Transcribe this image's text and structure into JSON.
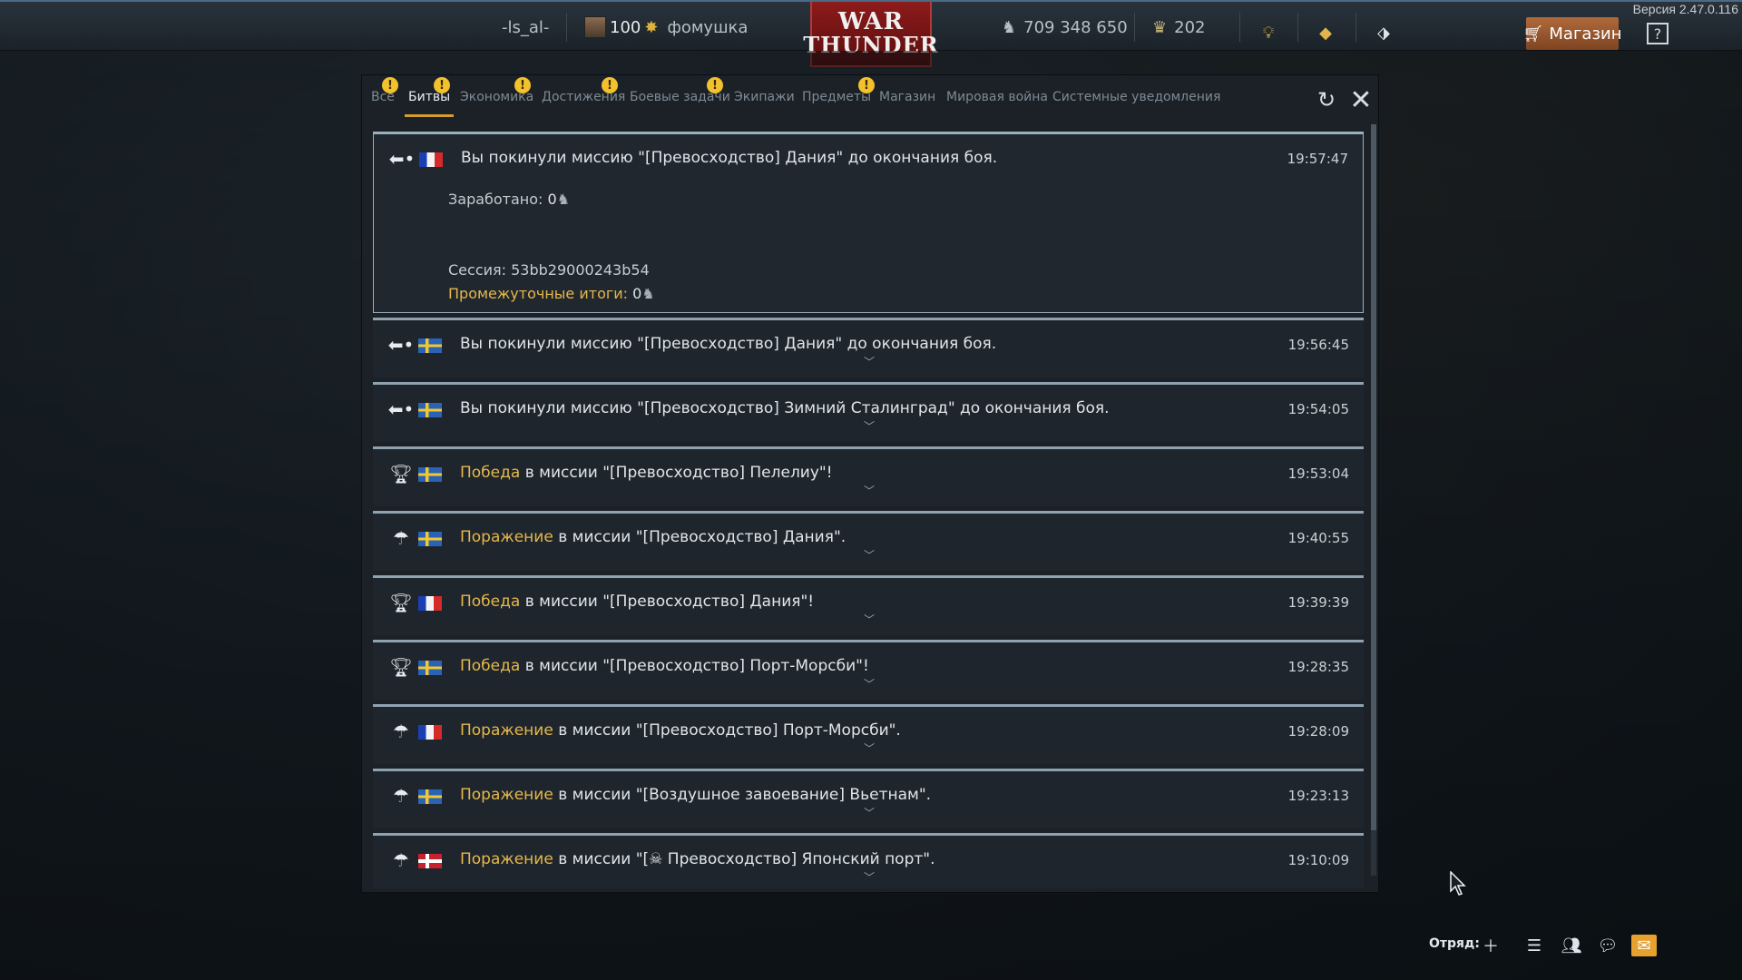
{
  "version": "Версия 2.47.0.116",
  "topbar": {
    "player_name": "-ls_al-",
    "level": "100",
    "title": "фомушка",
    "logo_line1": "WAR",
    "logo_line2": "THUNDER",
    "silver_lions": "709 348 650",
    "golden_eagles": "202",
    "shop_label": "Магазин",
    "help_label": "?"
  },
  "tabs": [
    {
      "label": "Все",
      "badge": "!"
    },
    {
      "label": "Битвы",
      "badge": "!",
      "active": true
    },
    {
      "label": "Экономика",
      "badge": "!"
    },
    {
      "label": "Достижения",
      "badge": "!"
    },
    {
      "label": "Боевые задачи",
      "badge": "!"
    },
    {
      "label": "Экипажи",
      "badge": ""
    },
    {
      "label": "Предметы",
      "badge": "!"
    },
    {
      "label": "Магазин",
      "badge": ""
    },
    {
      "label": "Мировая война",
      "badge": ""
    },
    {
      "label": "Системные уведомления",
      "badge": ""
    }
  ],
  "messages": [
    {
      "icon": "leave-icon",
      "flag": "france",
      "title": "Вы покинули миссию \"[Превосходство] Дания\" до окончания боя.",
      "time": "19:57:47",
      "earned_label": "Заработано:",
      "earned_value": "0",
      "session_label": "Сессия:",
      "session_value": "53bb29000243b54",
      "interim_label": "Промежуточные итоги:",
      "interim_value": "0"
    },
    {
      "icon": "leave-icon",
      "flag": "sweden",
      "result": "",
      "title": "Вы покинули миссию \"[Превосходство] Дания\" до окончания боя.",
      "time": "19:56:45"
    },
    {
      "icon": "leave-icon",
      "flag": "sweden",
      "result": "",
      "title": "Вы покинули миссию \"[Превосходство] Зимний Сталинград\" до окончания боя.",
      "time": "19:54:05"
    },
    {
      "icon": "trophy-icon",
      "flag": "sweden",
      "result": "Победа",
      "title": " в миссии \"[Превосходство] Пелелиу\"!",
      "time": "19:53:04"
    },
    {
      "icon": "parachute-icon",
      "flag": "sweden",
      "result": "Поражение",
      "title": " в миссии \"[Превосходство] Дания\".",
      "time": "19:40:55"
    },
    {
      "icon": "trophy-icon",
      "flag": "france",
      "result": "Победа",
      "title": " в миссии \"[Превосходство] Дания\"!",
      "time": "19:39:39"
    },
    {
      "icon": "trophy-icon",
      "flag": "sweden",
      "result": "Победа",
      "title": " в миссии \"[Превосходство] Порт-Морсби\"!",
      "time": "19:28:35"
    },
    {
      "icon": "parachute-icon",
      "flag": "france",
      "result": "Поражение",
      "title": " в миссии \"[Превосходство] Порт-Морсби\".",
      "time": "19:28:09"
    },
    {
      "icon": "parachute-icon",
      "flag": "sweden",
      "result": "Поражение",
      "title": " в миссии \"[Воздушное завоевание] Вьетнам\".",
      "time": "19:23:13"
    },
    {
      "icon": "parachute-icon",
      "flag": "japan",
      "result": "Поражение",
      "title": " в миссии \"[☠ Превосходство] Японский порт\".",
      "time": "19:10:09"
    }
  ],
  "bottombar": {
    "squad_label": "Отряд:"
  }
}
